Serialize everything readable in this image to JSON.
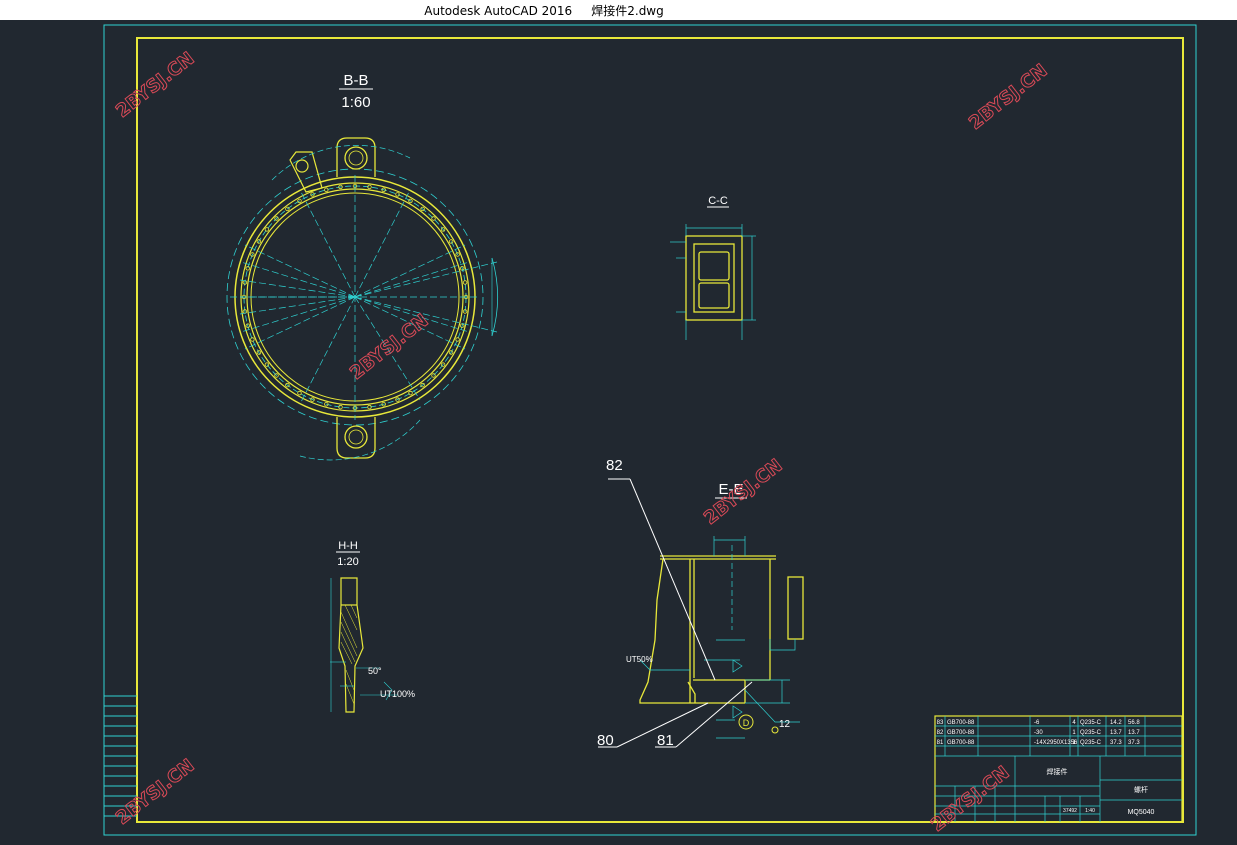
{
  "window": {
    "title": "Autodesk AutoCAD 2016     焊接件2.dwg"
  },
  "colors": {
    "background": "#212830",
    "frame_yellow": "#e8e83a",
    "cyan": "#2fd2d2",
    "white": "#ffffff",
    "watermark_red": "#d94a57"
  },
  "watermark": "2BYSJ.CN",
  "views": {
    "bb": {
      "label": "B-B",
      "scale": "1:60"
    },
    "cc": {
      "label": "C-C"
    },
    "hh": {
      "label": "H-H",
      "scale": "1:20",
      "angle": "50°",
      "weld_note": "UT100%"
    },
    "ee": {
      "label": "E-E",
      "weld_note": "UT50%",
      "leaders": [
        "82",
        "80",
        "81"
      ],
      "dim_12": "12",
      "circle_d": "D"
    }
  },
  "parts_table": [
    {
      "no": "83",
      "std": "GB700-88",
      "spec": "-6",
      "qty": "4",
      "mat": "Q235-C",
      "unit": "14.2",
      "total": "56.8"
    },
    {
      "no": "82",
      "std": "GB700-88",
      "spec": "-30",
      "qty": "1",
      "mat": "Q235-C",
      "unit": "13.7",
      "total": "13.7"
    },
    {
      "no": "81",
      "std": "GB700-88",
      "spec": "-14X2950X1356",
      "qty": "1",
      "mat": "Q235-C",
      "unit": "37.3",
      "total": "37.3"
    }
  ],
  "title_block": {
    "name": "焊接件",
    "company": "螺杆",
    "drawing_no": "MQ5040",
    "weight": "37492",
    "scale": "1:40"
  }
}
